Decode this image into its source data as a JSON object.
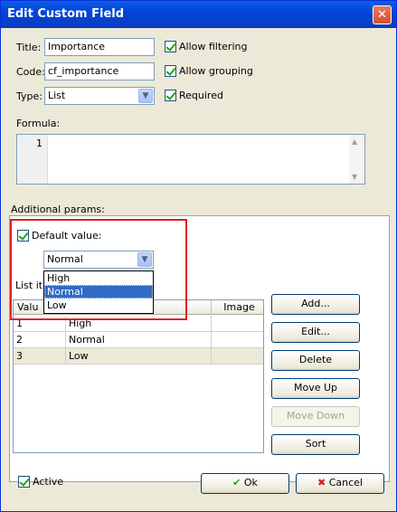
{
  "window": {
    "title": "Edit Custom Field",
    "close_glyph": "✕"
  },
  "fields": {
    "title_label": "Title:",
    "title_value": "Importance",
    "code_label": "Code:",
    "code_value": "cf_importance",
    "type_label": "Type:",
    "type_value": "List"
  },
  "checks": {
    "allow_filtering": "Allow filtering",
    "allow_grouping": "Allow grouping",
    "required": "Required"
  },
  "formula": {
    "label": "Formula:",
    "line_number": "1",
    "text": ""
  },
  "additional": {
    "label": "Additional params:",
    "default_value_label": "Default value:",
    "default_value": "Normal",
    "options": [
      "High",
      "Normal",
      "Low"
    ],
    "highlighted_option": "Normal",
    "list_items_label": "List ite"
  },
  "grid": {
    "headers": [
      "Valu",
      "",
      "Image"
    ],
    "rows": [
      {
        "value": "1",
        "text": "High",
        "image": ""
      },
      {
        "value": "2",
        "text": "Normal",
        "image": ""
      },
      {
        "value": "3",
        "text": "Low",
        "image": ""
      }
    ]
  },
  "list_buttons": {
    "add": "Add...",
    "edit": "Edit...",
    "delete": "Delete",
    "move_up": "Move Up",
    "move_down": "Move Down",
    "sort": "Sort"
  },
  "footer": {
    "active_label": "Active",
    "ok": "Ok",
    "cancel": "Cancel"
  },
  "colors": {
    "title_bar": "#0a5ee8",
    "highlight": "#316ac5",
    "annotation_box": "#e02020",
    "check": "#21a121",
    "cancel_x": "#d2201f"
  },
  "icons": {
    "ok": "check-icon",
    "cancel": "x-icon",
    "dropdown": "chevron-down-icon"
  }
}
